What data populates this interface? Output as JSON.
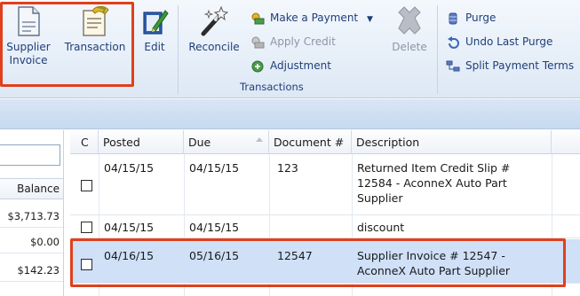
{
  "ribbon": {
    "supplier_invoice_line1": "Supplier",
    "supplier_invoice_line2": "Invoice",
    "transaction": "Transaction",
    "edit": "Edit",
    "reconcile": "Reconcile",
    "make_payment": "Make a Payment",
    "apply_credit": "Apply Credit",
    "adjustment": "Adjustment",
    "delete": "Delete",
    "purge": "Purge",
    "undo_last_purge": "Undo Last Purge",
    "split_payment_terms": "Split Payment Terms",
    "group_label": "Transactions"
  },
  "left_panel": {
    "header": "Balance",
    "balances": [
      "$3,713.73",
      "$0.00",
      "$142.23"
    ]
  },
  "grid": {
    "columns": [
      "C",
      "Posted",
      "Due",
      "Document #",
      "Description"
    ],
    "rows": [
      {
        "posted": "04/15/15",
        "due": "04/15/15",
        "document": "123",
        "desc1": "Returned Item Credit Slip #",
        "desc2": "12584 - AconneX Auto Part",
        "desc3": "Supplier"
      },
      {
        "posted": "04/15/15",
        "due": "04/15/15",
        "document": "",
        "desc1": "discount",
        "desc2": "",
        "desc3": ""
      },
      {
        "posted": "04/16/15",
        "due": "05/16/15",
        "document": "12547",
        "desc1": "Supplier Invoice # 12547 -",
        "desc2": "AconneX Auto Part Supplier",
        "desc3": ""
      }
    ]
  },
  "colors": {
    "highlight": "#e0401c",
    "ribbon_text": "#1f3e78",
    "selected_row": "#cfe0f7"
  }
}
